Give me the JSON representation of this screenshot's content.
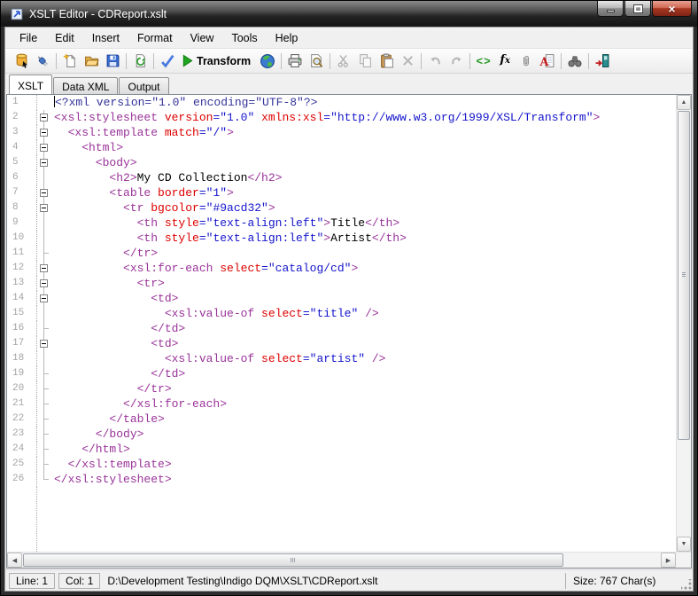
{
  "window": {
    "title": "XSLT Editor - CDReport.xslt",
    "controls": [
      {
        "name": "minimize-button",
        "glyph": "minimize"
      },
      {
        "name": "maximize-button",
        "glyph": "maximize"
      },
      {
        "name": "close-button",
        "glyph": "close"
      }
    ]
  },
  "menu": {
    "items": [
      "File",
      "Edit",
      "Insert",
      "Format",
      "View",
      "Tools",
      "Help"
    ]
  },
  "toolbar": {
    "items": [
      {
        "icon": "database-icon"
      },
      {
        "icon": "plug-icon"
      },
      {
        "sep": true
      },
      {
        "icon": "new-file-icon"
      },
      {
        "icon": "open-folder-icon"
      },
      {
        "icon": "save-icon"
      },
      {
        "sep": true
      },
      {
        "icon": "refresh-icon"
      },
      {
        "sep": true
      },
      {
        "icon": "validate-check-icon"
      },
      {
        "icon": "transform-play-icon",
        "label": "Transform"
      },
      {
        "icon": "globe-icon"
      },
      {
        "sep": true
      },
      {
        "icon": "print-icon"
      },
      {
        "icon": "print-preview-icon"
      },
      {
        "sep": true
      },
      {
        "icon": "cut-icon",
        "disabled": true
      },
      {
        "icon": "copy-icon",
        "disabled": true
      },
      {
        "icon": "paste-icon"
      },
      {
        "icon": "delete-icon",
        "disabled": true
      },
      {
        "sep": true
      },
      {
        "icon": "undo-icon",
        "disabled": true
      },
      {
        "icon": "redo-icon",
        "disabled": true
      },
      {
        "sep": true
      },
      {
        "icon": "code-tags-icon"
      },
      {
        "icon": "function-fx-icon"
      },
      {
        "icon": "paperclip-icon"
      },
      {
        "icon": "font-document-icon"
      },
      {
        "sep": true
      },
      {
        "icon": "find-binoculars-icon"
      },
      {
        "sep": true
      },
      {
        "icon": "exit-icon"
      }
    ]
  },
  "tabs": [
    {
      "label": "XSLT",
      "active": true
    },
    {
      "label": "Data XML",
      "active": false
    },
    {
      "label": "Output",
      "active": false
    }
  ],
  "editor": {
    "colors": {
      "tag": "#993399",
      "attr": "#dd0000",
      "value": "#1414cc",
      "text": "#000000",
      "pi": "#333399"
    },
    "lines": [
      {
        "n": 1,
        "fold": "none",
        "cursor": true,
        "seg": [
          [
            "p",
            "<?xml version=\"1.0\" encoding=\"UTF-8\"?>"
          ]
        ]
      },
      {
        "n": 2,
        "fold": "box",
        "seg": [
          [
            "t",
            "<xsl:stylesheet"
          ],
          [
            "a",
            " version"
          ],
          [
            "v",
            "=\"1.0\""
          ],
          [
            "a",
            " xmlns:xsl"
          ],
          [
            "v",
            "=\"http://www.w3.org/1999/XSL/Transform\""
          ],
          [
            "t",
            ">"
          ]
        ]
      },
      {
        "n": 3,
        "fold": "box",
        "seg": [
          [
            "t",
            "  <xsl:template"
          ],
          [
            "a",
            " match"
          ],
          [
            "v",
            "=\"/\""
          ],
          [
            "t",
            ">"
          ]
        ]
      },
      {
        "n": 4,
        "fold": "box",
        "seg": [
          [
            "t",
            "    <html>"
          ]
        ]
      },
      {
        "n": 5,
        "fold": "box",
        "seg": [
          [
            "t",
            "      <body>"
          ]
        ]
      },
      {
        "n": 6,
        "fold": "line",
        "seg": [
          [
            "t",
            "        <h2>"
          ],
          [
            "x",
            "My CD Collection"
          ],
          [
            "t",
            "</h2>"
          ]
        ]
      },
      {
        "n": 7,
        "fold": "box",
        "seg": [
          [
            "t",
            "        <table"
          ],
          [
            "a",
            " border"
          ],
          [
            "v",
            "=\"1\""
          ],
          [
            "t",
            ">"
          ]
        ]
      },
      {
        "n": 8,
        "fold": "box",
        "seg": [
          [
            "t",
            "          <tr"
          ],
          [
            "a",
            " bgcolor"
          ],
          [
            "v",
            "=\"#9acd32\""
          ],
          [
            "t",
            ">"
          ]
        ]
      },
      {
        "n": 9,
        "fold": "line",
        "seg": [
          [
            "t",
            "            <th"
          ],
          [
            "a",
            " style"
          ],
          [
            "v",
            "=\"text-align:left\""
          ],
          [
            "t",
            ">"
          ],
          [
            "x",
            "Title"
          ],
          [
            "t",
            "</th>"
          ]
        ]
      },
      {
        "n": 10,
        "fold": "line",
        "seg": [
          [
            "t",
            "            <th"
          ],
          [
            "a",
            " style"
          ],
          [
            "v",
            "=\"text-align:left\""
          ],
          [
            "t",
            ">"
          ],
          [
            "x",
            "Artist"
          ],
          [
            "t",
            "</th>"
          ]
        ]
      },
      {
        "n": 11,
        "fold": "tick",
        "seg": [
          [
            "t",
            "          </tr>"
          ]
        ]
      },
      {
        "n": 12,
        "fold": "box",
        "seg": [
          [
            "t",
            "          <xsl:for-each"
          ],
          [
            "a",
            " select"
          ],
          [
            "v",
            "=\"catalog/cd\""
          ],
          [
            "t",
            ">"
          ]
        ]
      },
      {
        "n": 13,
        "fold": "box",
        "seg": [
          [
            "t",
            "            <tr>"
          ]
        ]
      },
      {
        "n": 14,
        "fold": "box",
        "seg": [
          [
            "t",
            "              <td>"
          ]
        ]
      },
      {
        "n": 15,
        "fold": "line",
        "seg": [
          [
            "t",
            "                <xsl:value-of"
          ],
          [
            "a",
            " select"
          ],
          [
            "v",
            "=\"title\""
          ],
          [
            "t",
            " />"
          ]
        ]
      },
      {
        "n": 16,
        "fold": "tick",
        "seg": [
          [
            "t",
            "              </td>"
          ]
        ]
      },
      {
        "n": 17,
        "fold": "box",
        "seg": [
          [
            "t",
            "              <td>"
          ]
        ]
      },
      {
        "n": 18,
        "fold": "line",
        "seg": [
          [
            "t",
            "                <xsl:value-of"
          ],
          [
            "a",
            " select"
          ],
          [
            "v",
            "=\"artist\""
          ],
          [
            "t",
            " />"
          ]
        ]
      },
      {
        "n": 19,
        "fold": "tick",
        "seg": [
          [
            "t",
            "              </td>"
          ]
        ]
      },
      {
        "n": 20,
        "fold": "tick",
        "seg": [
          [
            "t",
            "            </tr>"
          ]
        ]
      },
      {
        "n": 21,
        "fold": "tick",
        "seg": [
          [
            "t",
            "          </xsl:for-each>"
          ]
        ]
      },
      {
        "n": 22,
        "fold": "tick",
        "seg": [
          [
            "t",
            "        </table>"
          ]
        ]
      },
      {
        "n": 23,
        "fold": "tick",
        "seg": [
          [
            "t",
            "      </body>"
          ]
        ]
      },
      {
        "n": 24,
        "fold": "tick",
        "seg": [
          [
            "t",
            "    </html>"
          ]
        ]
      },
      {
        "n": 25,
        "fold": "tick",
        "seg": [
          [
            "t",
            "  </xsl:template>"
          ]
        ]
      },
      {
        "n": 26,
        "fold": "end",
        "seg": [
          [
            "t",
            "</xsl:stylesheet>"
          ]
        ]
      }
    ]
  },
  "statusbar": {
    "line": "Line: 1",
    "col": "Col: 1",
    "path": "D:\\Development Testing\\Indigo DQM\\XSLT\\CDReport.xslt",
    "size": "Size: 767 Char(s)"
  }
}
